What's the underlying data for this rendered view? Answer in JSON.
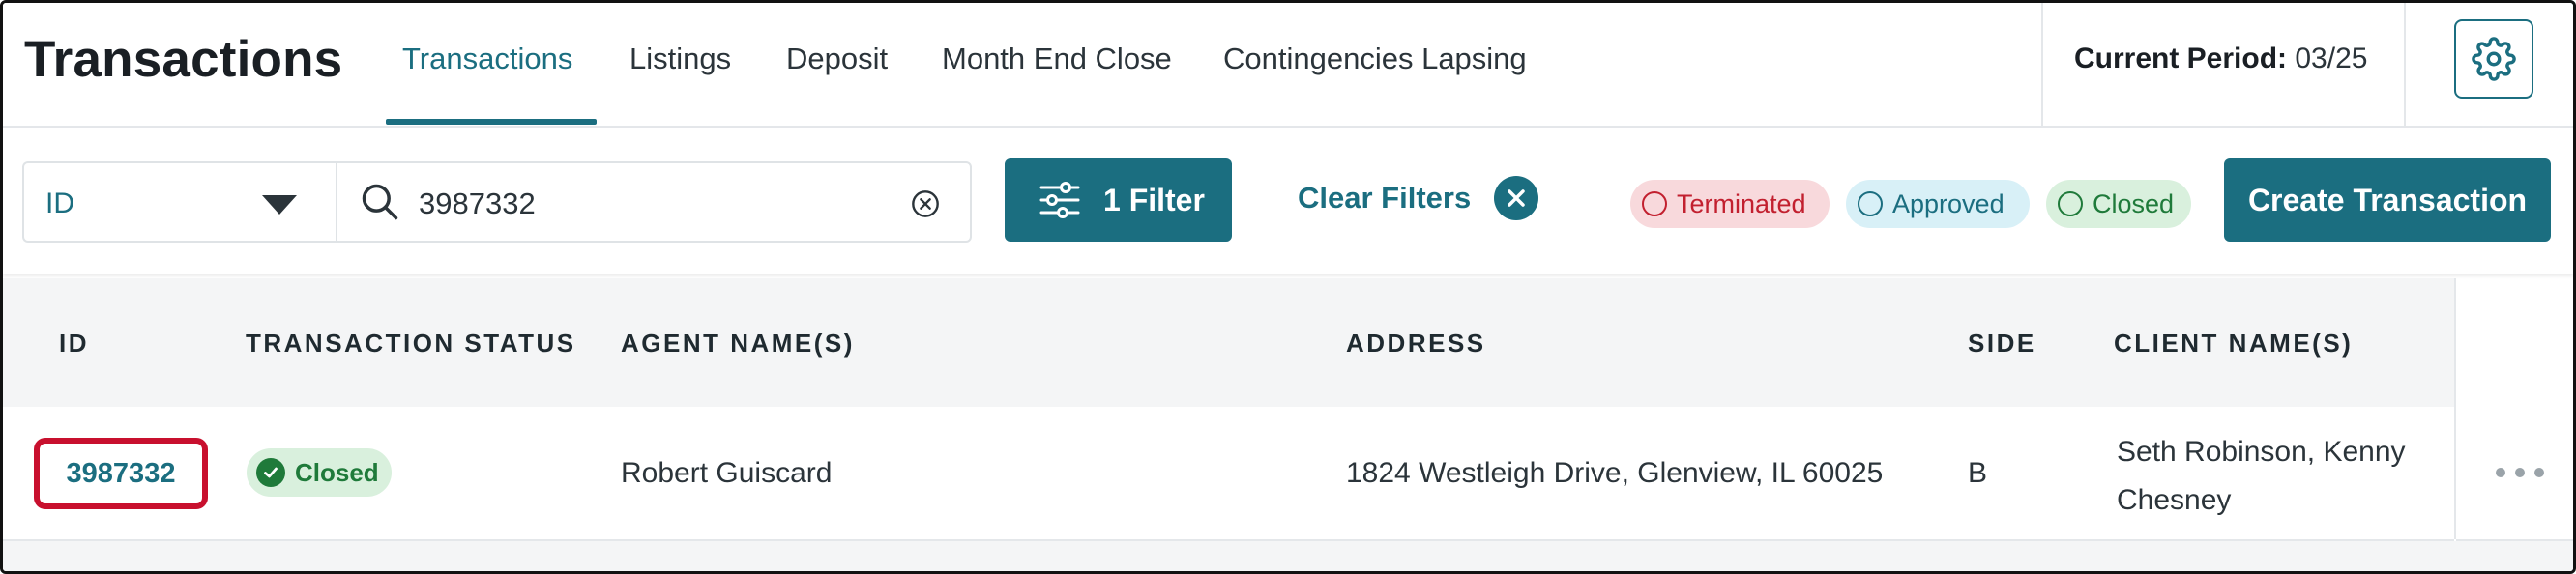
{
  "app": {
    "title": "Transactions"
  },
  "nav": {
    "tabs": [
      {
        "label": "Transactions",
        "active": true
      },
      {
        "label": "Listings"
      },
      {
        "label": "Deposit"
      },
      {
        "label": "Month End Close"
      },
      {
        "label": "Contingencies Lapsing"
      }
    ]
  },
  "period": {
    "label": "Current Period:",
    "value": "03/25"
  },
  "icons": {
    "settings": "gear-icon",
    "dropdown": "chevron-down-icon",
    "search": "search-icon",
    "clear_search": "clear-circle-icon",
    "filter": "sliders-icon",
    "clear_filters": "close-circle-icon",
    "status": "check-circle-icon",
    "row_menu": "more-horizontal-icon"
  },
  "toolbar": {
    "search_field": "ID",
    "search_value": "3987332",
    "filter_label": "1 Filter",
    "clear_filters_label": "Clear Filters",
    "status_chips": [
      {
        "label": "Terminated",
        "color": "#c2202f"
      },
      {
        "label": "Approved",
        "color": "#1b6e80"
      },
      {
        "label": "Closed",
        "color": "#1f7a3a"
      }
    ],
    "create_label": "Create Transaction"
  },
  "table": {
    "columns": [
      "ID",
      "TRANSACTION STATUS",
      "AGENT NAME(S)",
      "ADDRESS",
      "SIDE",
      "CLIENT NAME(S)"
    ],
    "rows": [
      {
        "id": "3987332",
        "status": "Closed",
        "agent": "Robert Guiscard",
        "address": "1824 Westleigh Drive, Glenview, IL 60025",
        "side": "B",
        "client_line1": "Seth Robinson, Kenny",
        "client_line2": "Chesney"
      }
    ]
  },
  "colors": {
    "accent": "#1b6e80",
    "highlight": "#c8102e",
    "closed": "#1f7a3a",
    "terminated": "#c2202f"
  }
}
